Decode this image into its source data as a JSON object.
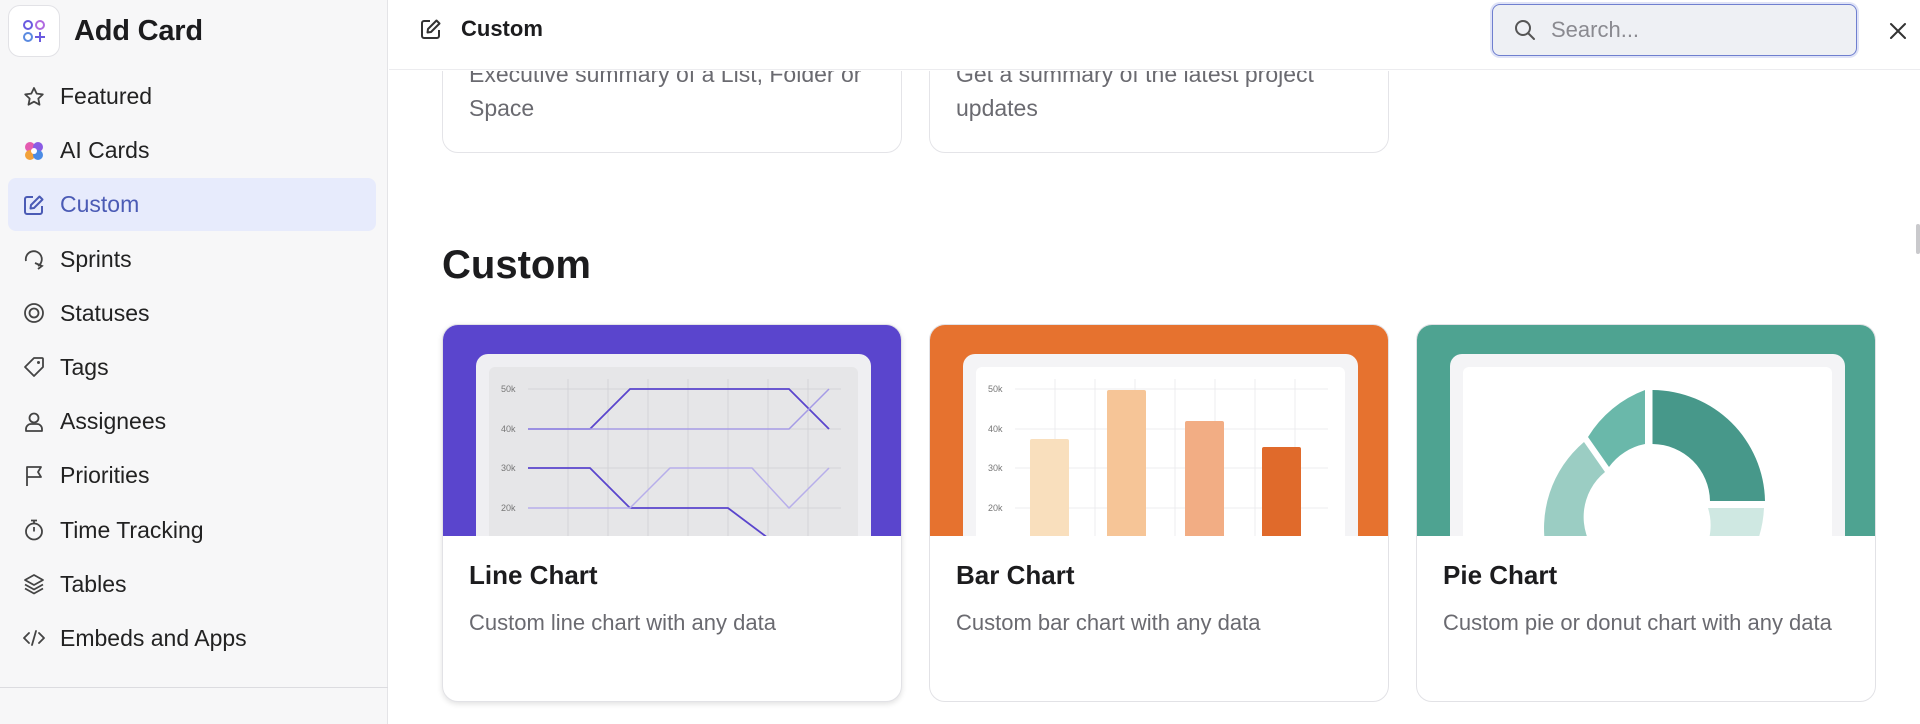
{
  "sidebar": {
    "title": "Add Card",
    "items": [
      {
        "label": "Featured",
        "icon": "star-icon"
      },
      {
        "label": "AI Cards",
        "icon": "ai-sparkle-icon"
      },
      {
        "label": "Custom",
        "icon": "edit-icon",
        "active": true
      },
      {
        "label": "Sprints",
        "icon": "sprint-icon"
      },
      {
        "label": "Statuses",
        "icon": "status-icon"
      },
      {
        "label": "Tags",
        "icon": "tag-icon"
      },
      {
        "label": "Assignees",
        "icon": "person-icon"
      },
      {
        "label": "Priorities",
        "icon": "flag-icon"
      },
      {
        "label": "Time Tracking",
        "icon": "stopwatch-icon"
      },
      {
        "label": "Tables",
        "icon": "layers-icon"
      },
      {
        "label": "Embeds and Apps",
        "icon": "code-icon"
      }
    ]
  },
  "header": {
    "title": "Custom",
    "search_placeholder": "Search..."
  },
  "main": {
    "top_cards": [
      {
        "desc": "Executive summary of a List, Folder or Space"
      },
      {
        "desc": "Get a summary of the latest project updates"
      }
    ],
    "section_title": "Custom",
    "cards": [
      {
        "name": "Line Chart",
        "desc": "Custom line chart with any data",
        "banner_color": "#5a45cd"
      },
      {
        "name": "Bar Chart",
        "desc": "Custom bar chart with any data",
        "banner_color": "#e6722f"
      },
      {
        "name": "Pie Chart",
        "desc": "Custom pie or donut chart with any data",
        "banner_color": "#4ea391"
      }
    ],
    "preview_ticks": [
      "50k",
      "40k",
      "30k",
      "20k"
    ]
  }
}
